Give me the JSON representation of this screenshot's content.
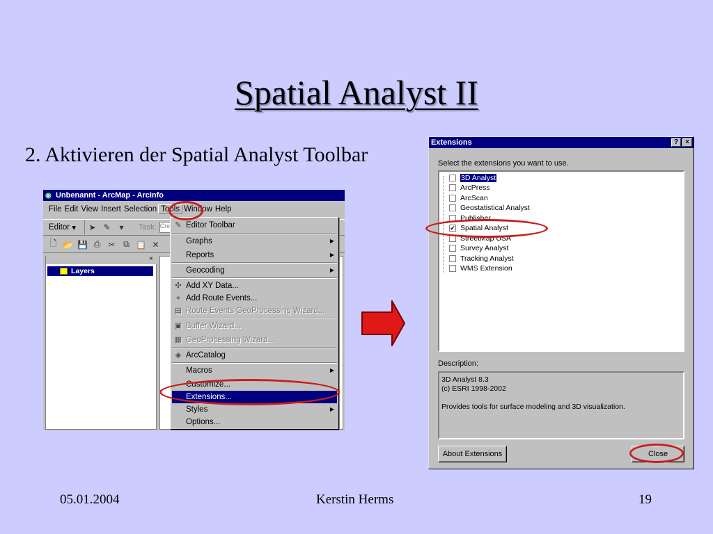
{
  "slide": {
    "title": "Spatial Analyst II",
    "subtitle": "2. Aktivieren der Spatial Analyst Toolbar",
    "footer_date": "05.01.2004",
    "footer_author": "Kerstin Herms",
    "footer_page": "19"
  },
  "arcmap": {
    "window_title": "Unbenannt - ArcMap - ArcInfo",
    "menu": [
      "File",
      "Edit",
      "View",
      "Insert",
      "Selection",
      "Tools",
      "Window",
      "Help"
    ],
    "editor_label": "Editor",
    "task_label": "Task:",
    "task_value": "Crea",
    "toc_root": "Layers",
    "tools_menu": [
      {
        "label": "Editor Toolbar",
        "state": "normal",
        "submenu": false
      },
      {
        "label": "Graphs",
        "state": "normal",
        "submenu": true
      },
      {
        "label": "Reports",
        "state": "normal",
        "submenu": true
      },
      {
        "label": "Geocoding",
        "state": "normal",
        "submenu": true
      },
      {
        "label": "Add XY Data...",
        "state": "normal",
        "submenu": false
      },
      {
        "label": "Add Route Events...",
        "state": "normal",
        "submenu": false
      },
      {
        "label": "Route Events GeoProcessing Wizard...",
        "state": "disabled",
        "submenu": false
      },
      {
        "label": "Buffer Wizard...",
        "state": "disabled",
        "submenu": false
      },
      {
        "label": "GeoProcessing Wizard...",
        "state": "disabled",
        "submenu": false
      },
      {
        "label": "ArcCatalog",
        "state": "normal",
        "submenu": false
      },
      {
        "label": "Macros",
        "state": "normal",
        "submenu": true
      },
      {
        "label": "Customize...",
        "state": "normal",
        "submenu": false
      },
      {
        "label": "Extensions...",
        "state": "selected",
        "submenu": false
      },
      {
        "label": "Styles",
        "state": "normal",
        "submenu": true
      },
      {
        "label": "Options...",
        "state": "normal",
        "submenu": false
      }
    ]
  },
  "extensions_dialog": {
    "title": "Extensions",
    "help_btn": "?",
    "close_btn": "×",
    "prompt": "Select the extensions you want to use.",
    "items": [
      {
        "label": "3D Analyst",
        "checked": false,
        "highlighted": true
      },
      {
        "label": "ArcPress",
        "checked": false,
        "highlighted": false
      },
      {
        "label": "ArcScan",
        "checked": false,
        "highlighted": false
      },
      {
        "label": "Geostatistical Analyst",
        "checked": false,
        "highlighted": false
      },
      {
        "label": "Publisher",
        "checked": false,
        "highlighted": false
      },
      {
        "label": "Spatial Analyst",
        "checked": true,
        "highlighted": false
      },
      {
        "label": "StreetMap USA",
        "checked": false,
        "highlighted": false
      },
      {
        "label": "Survey Analyst",
        "checked": false,
        "highlighted": false
      },
      {
        "label": "Tracking Analyst",
        "checked": false,
        "highlighted": false
      },
      {
        "label": "WMS Extension",
        "checked": false,
        "highlighted": false
      }
    ],
    "description_label": "Description:",
    "description_lines": [
      "3D Analyst 8.3",
      "(c) ESRI 1998-2002",
      "",
      "Provides tools for surface modeling and 3D visualization."
    ],
    "about_btn": "About Extensions",
    "close_label": "Close"
  },
  "colors": {
    "background": "#ccccff",
    "titlebar": "#000080",
    "highlight_ring": "#c81e1e",
    "arrow_fill": "#e01818"
  }
}
